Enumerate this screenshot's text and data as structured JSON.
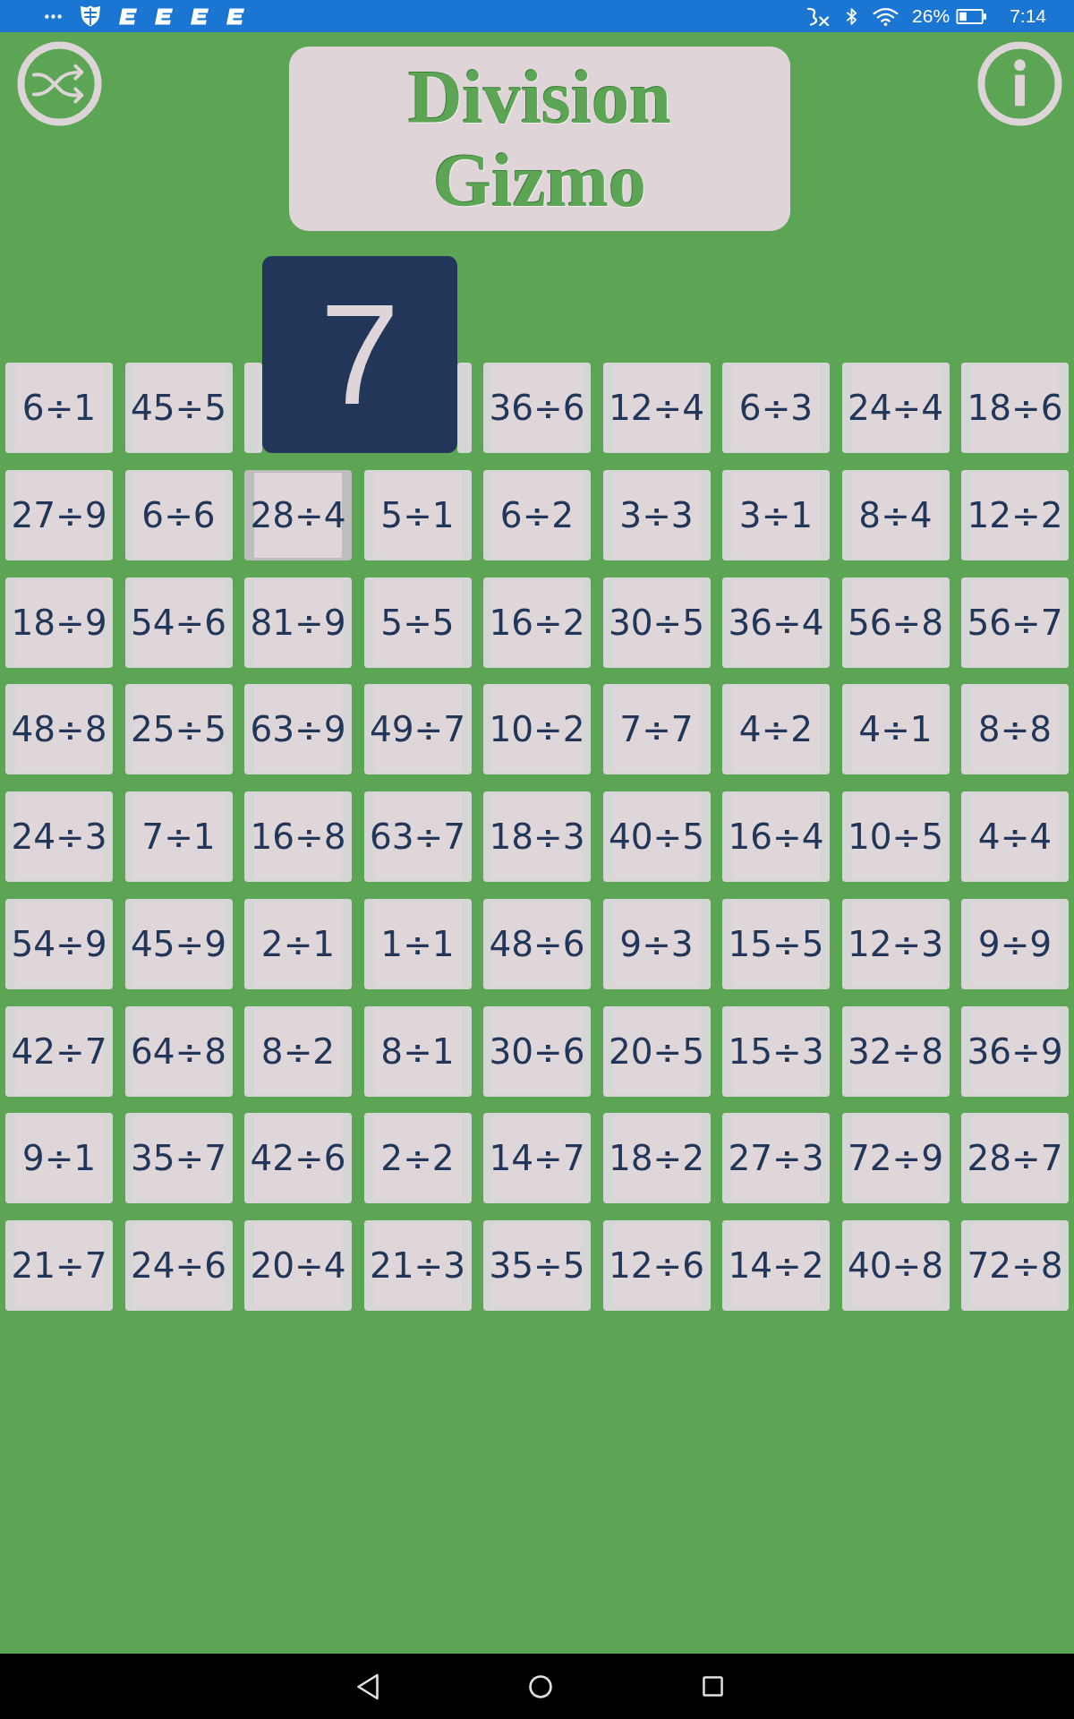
{
  "status_bar": {
    "battery": "26%",
    "time": "7:14"
  },
  "header": {
    "title": "Division Gizmo"
  },
  "answer_tile": {
    "value": "7"
  },
  "grid": {
    "rows": [
      [
        {
          "text": "6÷1",
          "selected": false
        },
        {
          "text": "45÷5",
          "selected": false
        },
        {
          "selected": false
        },
        {
          "selected": false
        },
        {
          "text": "36÷6",
          "selected": false
        },
        {
          "text": "12÷4",
          "selected": false
        },
        {
          "text": "6÷3",
          "selected": false
        },
        {
          "text": "24÷4",
          "selected": false
        },
        {
          "text": "18÷6",
          "selected": false
        }
      ],
      [
        {
          "text": "27÷9",
          "selected": false
        },
        {
          "text": "6÷6",
          "selected": false
        },
        {
          "text": "28÷4",
          "selected": true
        },
        {
          "text": "5÷1",
          "selected": false
        },
        {
          "text": "6÷2",
          "selected": false
        },
        {
          "text": "3÷3",
          "selected": false
        },
        {
          "text": "3÷1",
          "selected": false
        },
        {
          "text": "8÷4",
          "selected": false
        },
        {
          "text": "12÷2",
          "selected": false
        }
      ],
      [
        {
          "text": "18÷9",
          "selected": false
        },
        {
          "text": "54÷6",
          "selected": false
        },
        {
          "text": "81÷9",
          "selected": false
        },
        {
          "text": "5÷5",
          "selected": false
        },
        {
          "text": "16÷2",
          "selected": false
        },
        {
          "text": "30÷5",
          "selected": false
        },
        {
          "text": "36÷4",
          "selected": false
        },
        {
          "text": "56÷8",
          "selected": false
        },
        {
          "text": "56÷7",
          "selected": false
        }
      ],
      [
        {
          "text": "48÷8",
          "selected": false
        },
        {
          "text": "25÷5",
          "selected": false
        },
        {
          "text": "63÷9",
          "selected": false
        },
        {
          "text": "49÷7",
          "selected": false
        },
        {
          "text": "10÷2",
          "selected": false
        },
        {
          "text": "7÷7",
          "selected": false
        },
        {
          "text": "4÷2",
          "selected": false
        },
        {
          "text": "4÷1",
          "selected": false
        },
        {
          "text": "8÷8",
          "selected": false
        }
      ],
      [
        {
          "text": "24÷3",
          "selected": false
        },
        {
          "text": "7÷1",
          "selected": false
        },
        {
          "text": "16÷8",
          "selected": false
        },
        {
          "text": "63÷7",
          "selected": false
        },
        {
          "text": "18÷3",
          "selected": false
        },
        {
          "text": "40÷5",
          "selected": false
        },
        {
          "text": "16÷4",
          "selected": false
        },
        {
          "text": "10÷5",
          "selected": false
        },
        {
          "text": "4÷4",
          "selected": false
        }
      ],
      [
        {
          "text": "54÷9",
          "selected": false
        },
        {
          "text": "45÷9",
          "selected": false
        },
        {
          "text": "2÷1",
          "selected": false
        },
        {
          "text": "1÷1",
          "selected": false
        },
        {
          "text": "48÷6",
          "selected": false
        },
        {
          "text": "9÷3",
          "selected": false
        },
        {
          "text": "15÷5",
          "selected": false
        },
        {
          "text": "12÷3",
          "selected": false
        },
        {
          "text": "9÷9",
          "selected": false
        }
      ],
      [
        {
          "text": "42÷7",
          "selected": false
        },
        {
          "text": "64÷8",
          "selected": false
        },
        {
          "text": "8÷2",
          "selected": false
        },
        {
          "text": "8÷1",
          "selected": false
        },
        {
          "text": "30÷6",
          "selected": false
        },
        {
          "text": "20÷5",
          "selected": false
        },
        {
          "text": "15÷3",
          "selected": false
        },
        {
          "text": "32÷8",
          "selected": false
        },
        {
          "text": "36÷9",
          "selected": false
        }
      ],
      [
        {
          "text": "9÷1",
          "selected": false
        },
        {
          "text": "35÷7",
          "selected": false
        },
        {
          "text": "42÷6",
          "selected": false
        },
        {
          "text": "2÷2",
          "selected": false
        },
        {
          "text": "14÷7",
          "selected": false
        },
        {
          "text": "18÷2",
          "selected": false
        },
        {
          "text": "27÷3",
          "selected": false
        },
        {
          "text": "72÷9",
          "selected": false
        },
        {
          "text": "28÷7",
          "selected": false
        }
      ],
      [
        {
          "text": "21÷7",
          "selected": false
        },
        {
          "text": "24÷6",
          "selected": false
        },
        {
          "text": "20÷4",
          "selected": false
        },
        {
          "text": "21÷3",
          "selected": false
        },
        {
          "text": "35÷5",
          "selected": false
        },
        {
          "text": "12÷6",
          "selected": false
        },
        {
          "text": "14÷2",
          "selected": false
        },
        {
          "text": "40÷8",
          "selected": false
        },
        {
          "text": "72÷8",
          "selected": false
        }
      ]
    ]
  }
}
